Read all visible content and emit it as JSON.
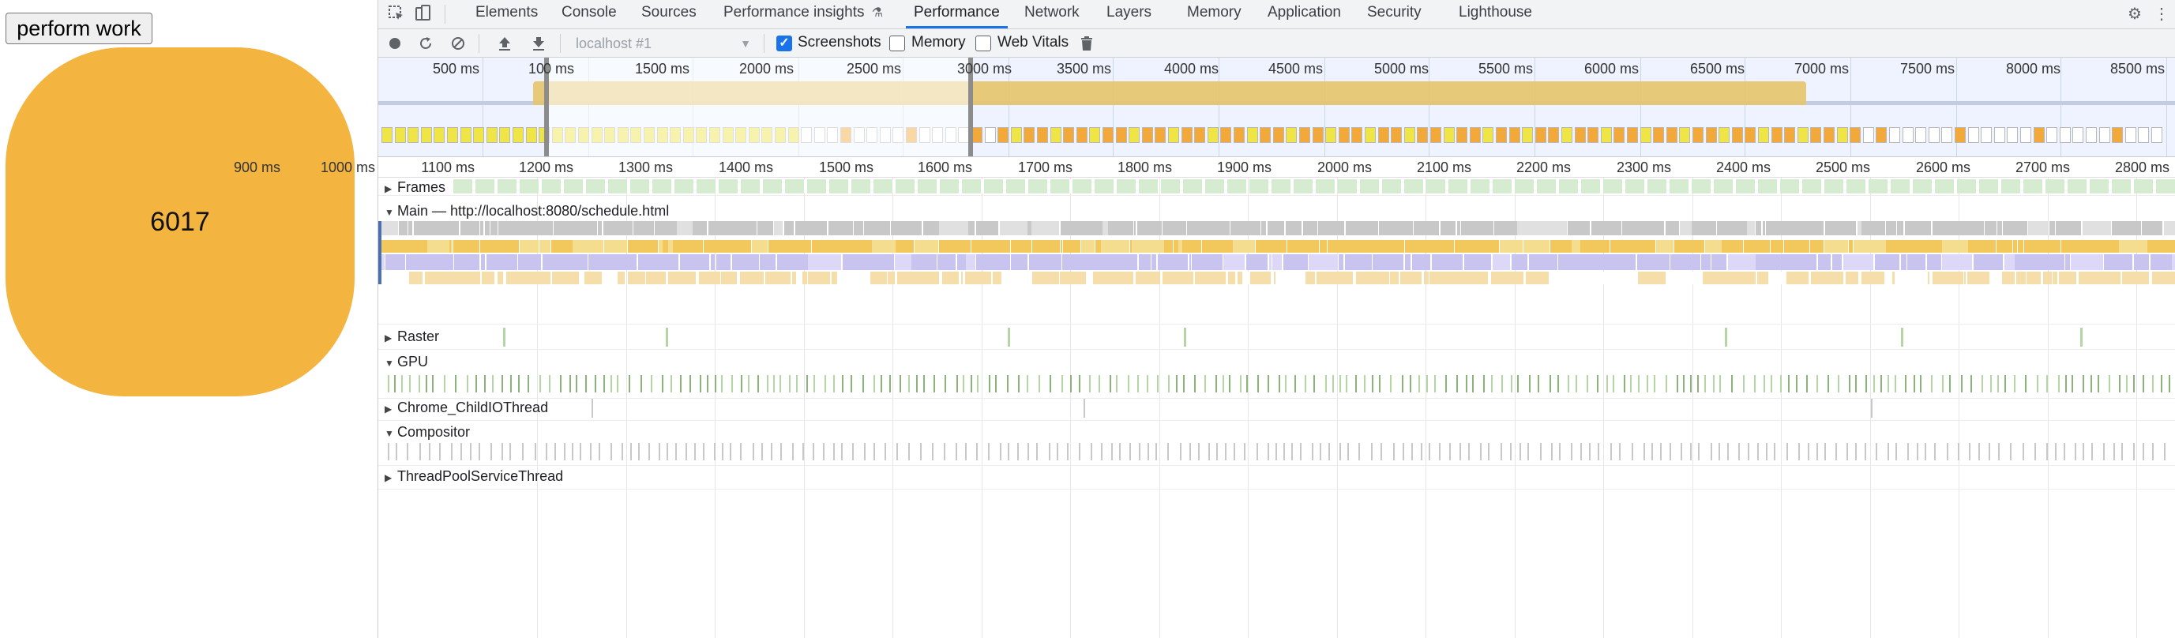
{
  "page": {
    "perform_button": "perform work",
    "counter_value": "6017",
    "counter_color": "#f3b440"
  },
  "devtools": {
    "tabs": [
      {
        "label": "Elements"
      },
      {
        "label": "Console"
      },
      {
        "label": "Sources"
      },
      {
        "label": "Performance insights",
        "badge_icon": "flask-icon"
      },
      {
        "label": "Performance",
        "active": true
      },
      {
        "label": "Network"
      },
      {
        "label": "Layers"
      },
      {
        "label": "Memory"
      },
      {
        "label": "Application"
      },
      {
        "label": "Security"
      },
      {
        "label": "Lighthouse"
      }
    ],
    "toolbar_icons": [
      "inspect-element-icon",
      "device-toolbar-icon",
      "settings-gear-icon",
      "more-menu-icon"
    ],
    "controls": {
      "record_icon": "record-icon",
      "reload_icon": "reload-record-icon",
      "clear_icon": "clear-icon",
      "upload_icon": "load-profile-icon",
      "download_icon": "save-profile-icon",
      "target": "localhost #1",
      "screenshots_label": "Screenshots",
      "screenshots_checked": true,
      "memory_label": "Memory",
      "memory_checked": false,
      "webvitals_label": "Web Vitals",
      "webvitals_checked": false,
      "trash_icon": "trash-icon"
    },
    "overview": {
      "labels": [
        "500 ms",
        "10",
        "0 ms",
        "1500 ms",
        "2000 ms",
        "2500 ms",
        "3000",
        "ms",
        "3500 ms",
        "4000 ms",
        "4500 ms",
        "5000 ms",
        "5500 ms",
        "6000 ms",
        "6500 ms",
        "7000 ms",
        "7500 ms",
        "8000 ms",
        "8500 ms"
      ]
    },
    "ruler": {
      "labels": [
        "900 ms",
        "1000 ms",
        "1100 ms",
        "1200 ms",
        "1300 ms",
        "1400 ms",
        "1500 ms",
        "1600 ms",
        "1700 ms",
        "1800 ms",
        "1900 ms",
        "2000 ms",
        "2100 ms",
        "2200 ms",
        "2300 ms",
        "2400 ms",
        "2500 ms",
        "2600 ms",
        "2700 ms",
        "2800 ms"
      ]
    },
    "tracks": {
      "frames": {
        "label": "Frames",
        "expanded": false
      },
      "main": {
        "label": "Main — http://localhost:8080/schedule.html",
        "expanded": true
      },
      "raster": {
        "label": "Raster",
        "expanded": false
      },
      "gpu": {
        "label": "GPU",
        "expanded": true
      },
      "io": {
        "label": "Chrome_ChildIOThread",
        "expanded": false
      },
      "compositor": {
        "label": "Compositor",
        "expanded": true
      },
      "threadpool": {
        "label": "ThreadPoolServiceThread",
        "expanded": false
      }
    },
    "colors": {
      "accent": "#1a73e8",
      "scripting": "#f2c75c",
      "rendering": "#c9c3ef",
      "painting": "#b3d6a4",
      "task": "#c8c8c8"
    }
  }
}
